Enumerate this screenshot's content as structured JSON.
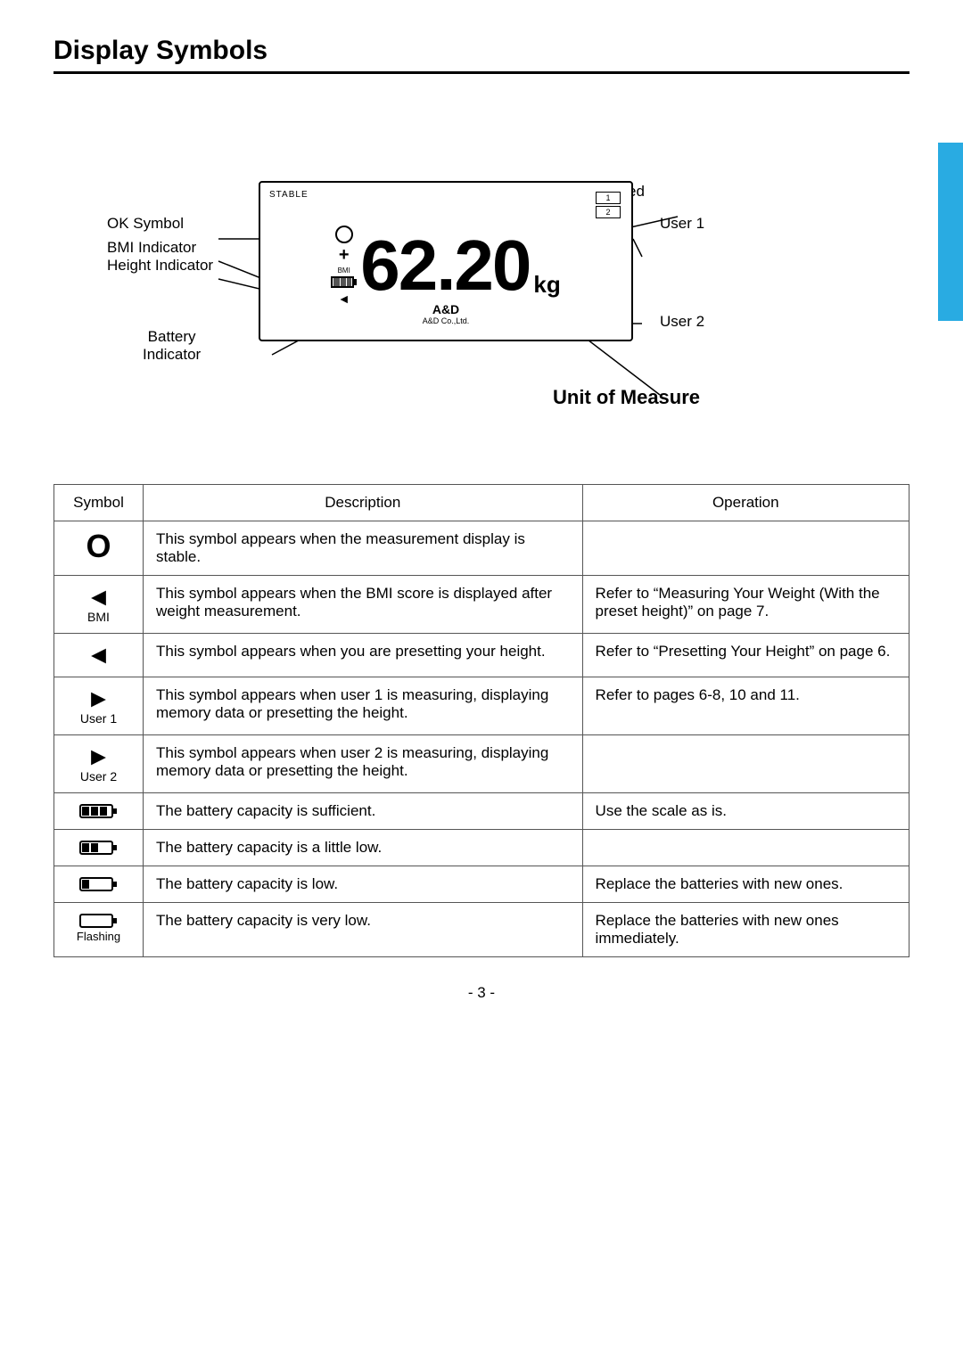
{
  "page": {
    "title": "Display Symbols",
    "page_number": "- 3 -"
  },
  "diagram": {
    "labels": {
      "ok_symbol": "OK Symbol",
      "weight_measured": "Weight Measured",
      "bmi_indicator": "BMI Indicator",
      "height_indicator": "Height Indicator",
      "battery_indicator": "Battery\nIndicator",
      "user1": "User 1",
      "user2": "User 2",
      "unit_of_measure": "Unit of Measure"
    },
    "scale": {
      "stable": "STABLE",
      "digits": "62.20",
      "unit": "kg",
      "bmi": "BMI",
      "brand": "A&D",
      "brand_sub": "A&D Co.,Ltd."
    }
  },
  "table": {
    "headers": [
      "Symbol",
      "Description",
      "Operation"
    ],
    "rows": [
      {
        "symbol_type": "circle",
        "symbol_label": "",
        "description": "This symbol appears when the measurement display is stable.",
        "operation": ""
      },
      {
        "symbol_type": "triangle-left",
        "symbol_label": "BMI",
        "description": "This symbol appears when the BMI score is displayed after weight measurement.",
        "operation": "Refer to “Measuring Your Weight (With the preset height)” on page 7."
      },
      {
        "symbol_type": "triangle-left",
        "symbol_label": "",
        "description": "This symbol appears when you are presetting your height.",
        "operation": "Refer to “Presetting Your Height” on page 6."
      },
      {
        "symbol_type": "triangle-right",
        "symbol_label": "User 1",
        "description": "This symbol appears when user 1 is measuring, displaying memory data or presetting the height.",
        "operation": "Refer to pages 6-8, 10 and 11."
      },
      {
        "symbol_type": "triangle-right",
        "symbol_label": "User 2",
        "description": "This symbol appears when user 2 is measuring, displaying memory data or presetting the height.",
        "operation": ""
      },
      {
        "symbol_type": "battery-full",
        "symbol_label": "",
        "description": "The battery capacity is sufficient.",
        "operation": "Use the scale as is."
      },
      {
        "symbol_type": "battery-medium",
        "symbol_label": "",
        "description": "The battery capacity is a little low.",
        "operation": ""
      },
      {
        "symbol_type": "battery-low",
        "symbol_label": "",
        "description": "The battery capacity is low.",
        "operation": "Replace the batteries with new ones."
      },
      {
        "symbol_type": "battery-verylow",
        "symbol_label": "Flashing",
        "description": "The battery capacity is very low.",
        "operation": "Replace the batteries with new ones immediately."
      }
    ]
  }
}
